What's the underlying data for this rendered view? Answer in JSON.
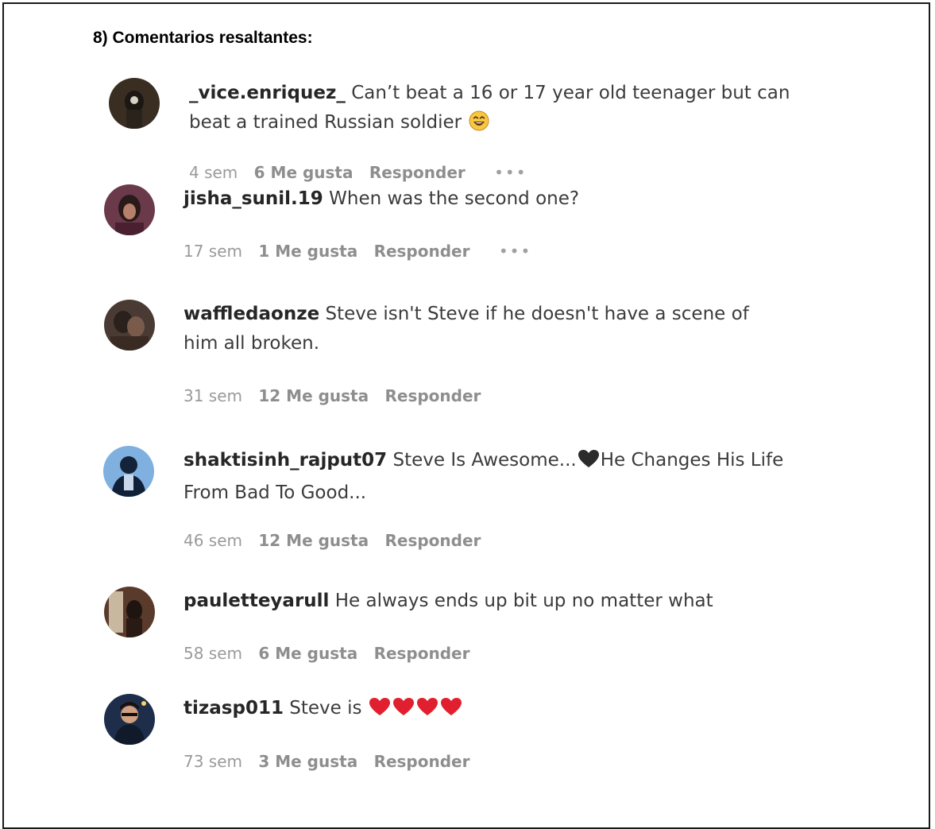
{
  "section_title": "8) Comentarios resaltantes:",
  "comments": [
    {
      "user": "_vice.enriquez_",
      "text": "Can’t beat a 16 or 17 year old teenager but can beat a trained Russian soldier",
      "time": "4 sem",
      "likes": "6 Me gusta",
      "reply": "Responder",
      "more": "•••",
      "emoji": "laughing-emoji"
    },
    {
      "user": "jisha_sunil.19",
      "text": "When was the second one?",
      "time": "17 sem",
      "likes": "1 Me gusta",
      "reply": "Responder",
      "more": "•••"
    },
    {
      "user": "waffledaonze",
      "text": "Steve isn't Steve if he doesn't have a scene of him all broken.",
      "time": "31 sem",
      "likes": "12 Me gusta",
      "reply": "Responder"
    },
    {
      "user": "shaktisinh_rajput07",
      "text_before": "Steve Is Awesome...",
      "text_after": "He Changes His Life From Bad To Good...",
      "time": "46 sem",
      "likes": "12 Me gusta",
      "reply": "Responder",
      "emoji": "black-heart-emoji"
    },
    {
      "user": "pauletteyarull",
      "text": "He always ends up bit up no matter what",
      "time": "58 sem",
      "likes": "6 Me gusta",
      "reply": "Responder"
    },
    {
      "user": "tizasp011",
      "text": "Steve is",
      "time": "73 sem",
      "likes": "3 Me gusta",
      "reply": "Responder",
      "emoji": "red-heart-emoji"
    }
  ],
  "colors": {
    "text": "#262626",
    "meta": "#8e8e8e",
    "heart_red": "#e0202e",
    "heart_black": "#2b2b2b"
  }
}
